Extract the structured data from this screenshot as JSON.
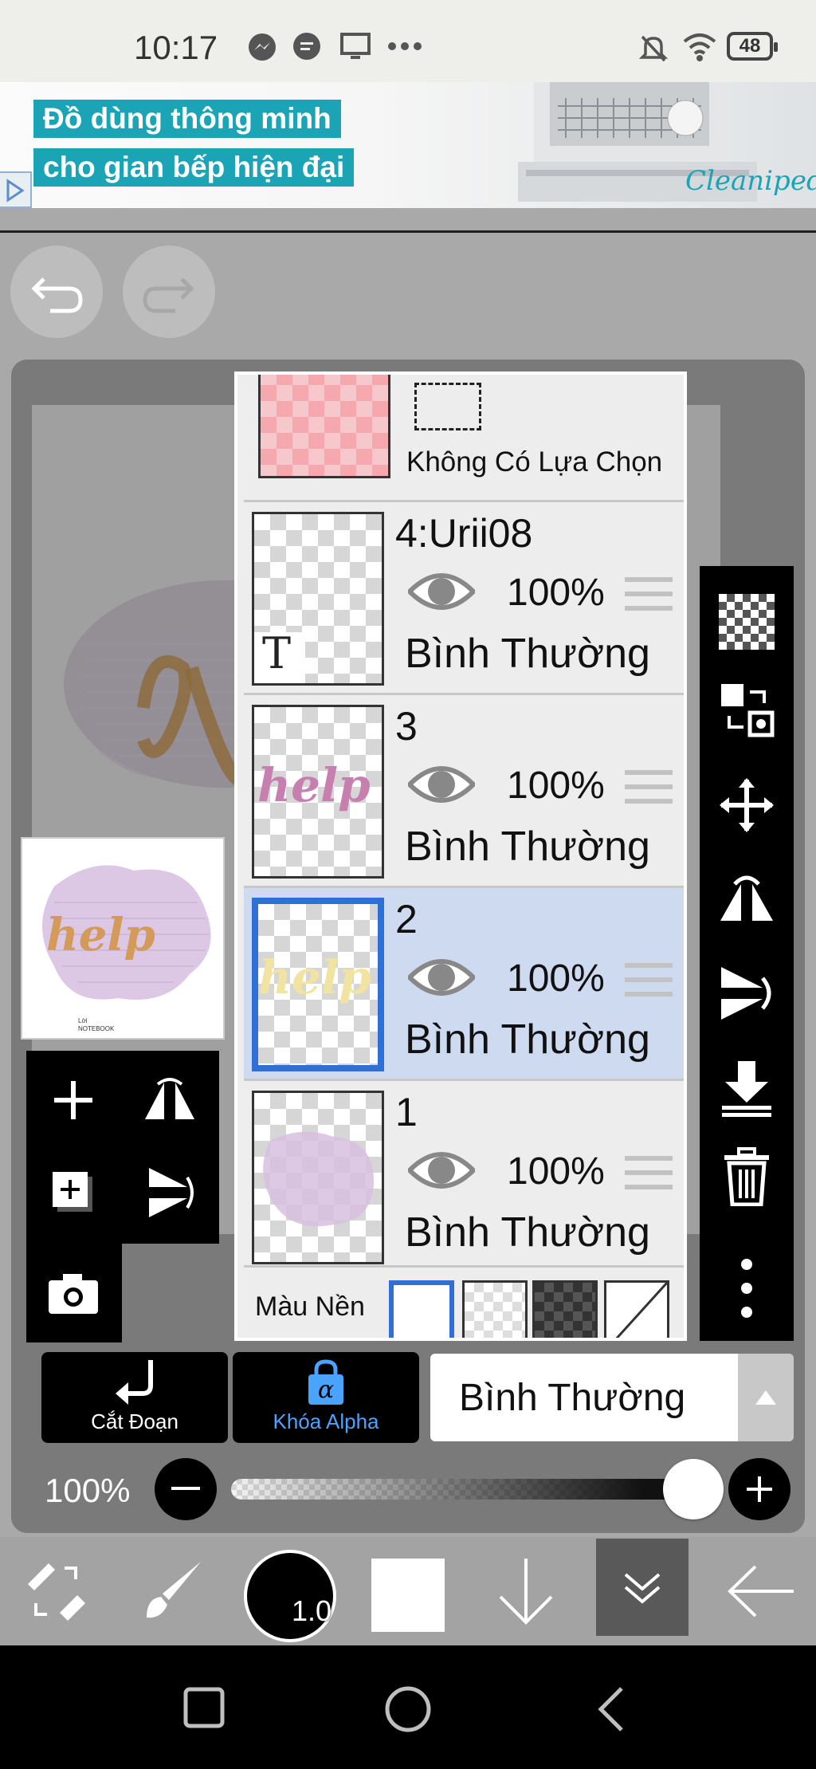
{
  "status_bar": {
    "time": "10:17",
    "battery": "48",
    "icons": [
      "messenger-icon",
      "chat-bubble-icon",
      "screen-cast-icon",
      "more-dots-icon",
      "bell-muted-icon",
      "wifi-icon",
      "battery-icon"
    ]
  },
  "ad": {
    "line1": "Đồ dùng thông minh",
    "line2": "cho gian bếp hiện đại",
    "brand": "Cleanipedia"
  },
  "canvas": {
    "thumbnail_word": "help",
    "thumbnail_caption1": "Lời",
    "thumbnail_caption2": "NOTEBOOK"
  },
  "layers": {
    "selection": {
      "label": "Không Có Lựa Chọn"
    },
    "items": [
      {
        "name": "4:Urii08",
        "opacity": "100%",
        "mode": "Bình Thường",
        "thumb_text": "T",
        "selected": false
      },
      {
        "name": "3",
        "opacity": "100%",
        "mode": "Bình Thường",
        "thumb_text": "help",
        "selected": false
      },
      {
        "name": "2",
        "opacity": "100%",
        "mode": "Bình Thường",
        "thumb_text": "help",
        "selected": true
      },
      {
        "name": "1",
        "opacity": "100%",
        "mode": "Bình Thường",
        "thumb_text": "",
        "selected": false
      }
    ],
    "background_label": "Màu Nền"
  },
  "actions": {
    "clip_label": "Cắt Đoạn",
    "alpha_lock_label": "Khóa Alpha",
    "blend_mode": "Bình Thường"
  },
  "opacity": {
    "label": "100%",
    "value": 1.0
  },
  "bottom_toolbar": {
    "brush_size": "1.0"
  },
  "colors": {
    "accent_blue": "#2f6fd6",
    "selected_layer_bg": "#cddaf0",
    "alpha_lock_blue": "#4aa3ff",
    "ad_teal": "#1ba3b6"
  }
}
